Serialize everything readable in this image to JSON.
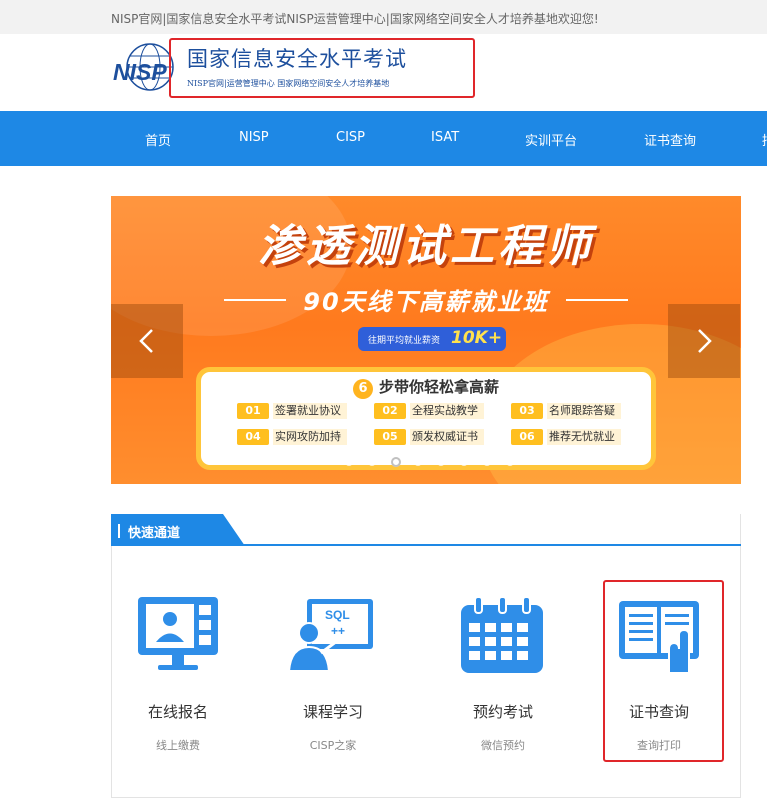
{
  "topbar": {
    "message": "NISP官网|国家信息安全水平考试NISP运营管理中心|国家网络空间安全人才培养基地欢迎您!"
  },
  "header": {
    "logo_text": "NISP",
    "title": "国家信息安全水平考试",
    "subtitle": "NISP官网|运营管理中心    国家网络空间安全人才培养基地"
  },
  "nav": {
    "items": [
      "首页",
      "NISP",
      "CISP",
      "ISAT",
      "实训平台",
      "证书查询",
      "招"
    ]
  },
  "banner": {
    "title": "渗透测试工程师",
    "subtitle": "90天线下高薪就业班",
    "salary_label": "往期平均就业薪资",
    "salary_value": "10K+",
    "card_number": "6",
    "card_title": "步带你轻松拿高薪",
    "features": [
      {
        "num": "01",
        "label": "签署就业协议"
      },
      {
        "num": "02",
        "label": "全程实战教学"
      },
      {
        "num": "03",
        "label": "名师跟踪答疑"
      },
      {
        "num": "04",
        "label": "实网攻防加持"
      },
      {
        "num": "05",
        "label": "颁发权威证书"
      },
      {
        "num": "06",
        "label": "推荐无忧就业"
      }
    ],
    "slide_count": 8,
    "active_slide": 3
  },
  "quick": {
    "title": "快速通道",
    "items": [
      {
        "label": "在线报名",
        "sub": "线上缴费",
        "icon": "online-registration-icon"
      },
      {
        "label": "课程学习",
        "sub": "CISP之家",
        "icon": "course-study-icon"
      },
      {
        "label": "预约考试",
        "sub": "微信预约",
        "icon": "calendar-icon"
      },
      {
        "label": "证书查询",
        "sub": "查询打印",
        "icon": "certificate-query-icon"
      }
    ]
  },
  "colors": {
    "primary": "#1e88e5",
    "highlight": "#e0262a",
    "banner": "#ff7a1e",
    "brand_text": "#1d4f9d"
  }
}
